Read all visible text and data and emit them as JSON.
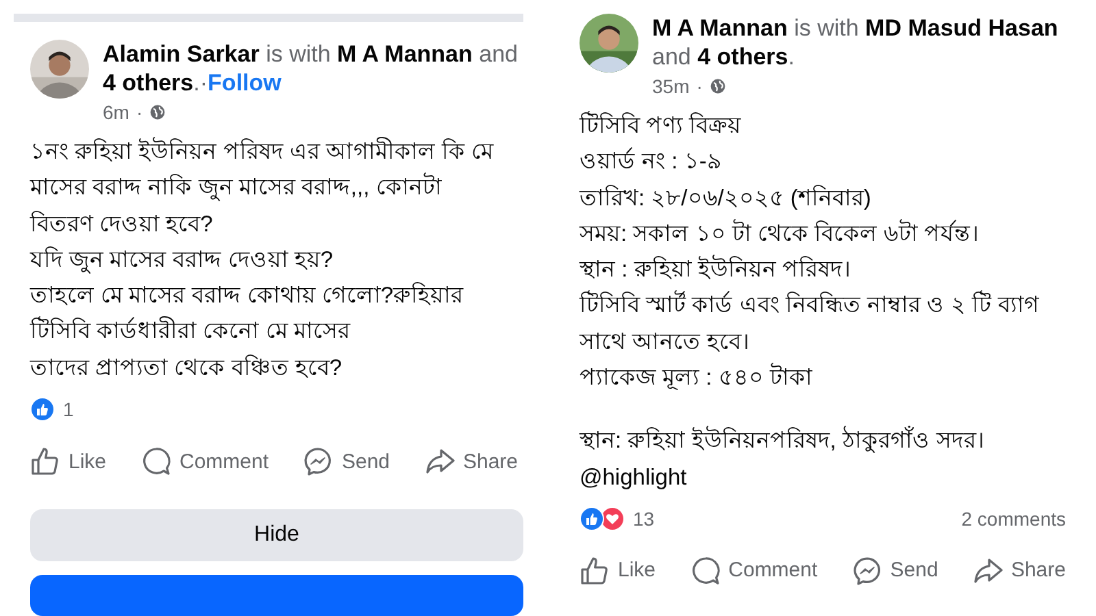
{
  "posts": [
    {
      "top_bar": true,
      "header": "**Alamin Sarkar** is with **M A Mannan** and **4 others**.",
      "follow_separator": "·",
      "follow": "Follow",
      "time": "6m",
      "time_separator": "·",
      "paragraphs": [
        [
          "১নং রুহিয়া ইউনিয়ন পরিষদ এর আগামীকাল কি মে",
          "মাসের বরাদ্দ নাকি জুন মাসের বরাদ্দ,,, কোনটা",
          "বিতরণ দেওয়া হবে?",
          "যদি জুন মাসের বরাদ্দ  দেওয়া হয়?",
          "তাহলে মে মাসের বরাদ্দ কোথায় গেলো?রুহিয়ার",
          "টিসিবি কার্ডধারীরা কেনো মে মাসের",
          "তাদের প্রাপ্যতা থেকে বঞ্চিত হবে?"
        ]
      ],
      "reactions": [
        {
          "kind": "like"
        }
      ],
      "reaction_count": "1",
      "actions": [
        {
          "kind": "like",
          "label": "Like"
        },
        {
          "kind": "comment",
          "label": "Comment"
        },
        {
          "kind": "send",
          "label": "Send"
        },
        {
          "kind": "share",
          "label": "Share"
        }
      ],
      "buttons": [
        {
          "kind": "secondary",
          "label": "Hide"
        },
        {
          "kind": "primary"
        }
      ]
    },
    {
      "header": "**M A Mannan** is with **MD Masud Hasan** and **4 others**.",
      "time": "35m",
      "time_separator": "·",
      "paragraphs": [
        [
          "টিসিবি পণ্য বিক্রয়",
          "ওয়ার্ড নং : ১-৯",
          "তারিখ: ২৮/০৬/২০২৫ (শনিবার)",
          "সময়: সকাল ১০ টা থেকে বিকেল ৬টা পর্যন্ত।",
          "স্থান : রুহিয়া ইউনিয়ন পরিষদ।",
          "টিসিবি স্মার্ট কার্ড এবং নিবন্ধিত নাম্বার ও ২ টি ব্যাগ",
          "সাথে আনতে হবে।",
          "প্যাকেজ মূল্য : ৫৪০ টাকা"
        ],
        [
          "স্থান: রুহিয়া ইউনিয়নপরিষদ, ঠাকুরগাঁও সদর।",
          "@highlight"
        ]
      ],
      "reactions": [
        {
          "kind": "like"
        },
        {
          "kind": "love"
        }
      ],
      "reaction_count": "13",
      "comments": "2 comments",
      "actions": [
        {
          "kind": "like",
          "label": "Like"
        },
        {
          "kind": "comment",
          "label": "Comment"
        },
        {
          "kind": "send",
          "label": "Send"
        },
        {
          "kind": "share",
          "label": "Share"
        }
      ]
    }
  ]
}
